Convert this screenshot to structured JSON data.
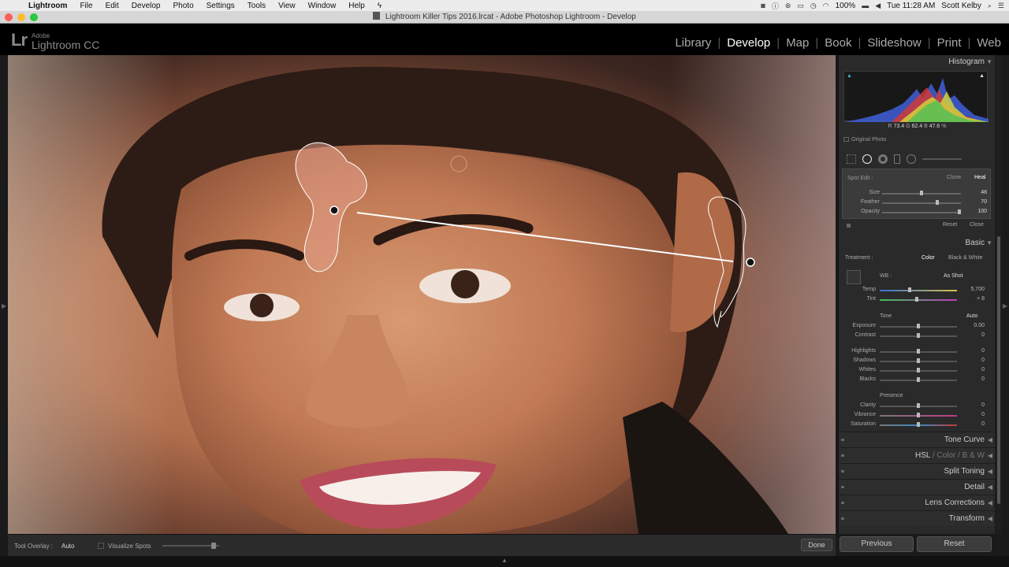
{
  "menubar": {
    "app": "Lightroom",
    "items": [
      "File",
      "Edit",
      "Develop",
      "Photo",
      "Settings",
      "Tools",
      "View",
      "Window",
      "Help"
    ],
    "battery": "100%",
    "clock": "Tue 11:28 AM",
    "user": "Scott Kelby"
  },
  "window": {
    "title": "Lightroom Killer Tips 2016.lrcat - Adobe Photoshop Lightroom - Develop"
  },
  "identity": {
    "adobe": "Adobe",
    "product": "Lightroom CC",
    "lr": "Lr"
  },
  "modules": [
    "Library",
    "Develop",
    "Map",
    "Book",
    "Slideshow",
    "Print",
    "Web"
  ],
  "active_module": "Develop",
  "histogram": {
    "title": "Histogram",
    "r_label": "R",
    "r_value": "73.4",
    "g_label": "G",
    "g_value": "62.4",
    "b_label": "B",
    "b_value": "47.6",
    "percent": "%",
    "original_photo": "Original Photo"
  },
  "spot_edit": {
    "title": "Spot Edit :",
    "clone": "Clone",
    "heal": "Heal",
    "size_label": "Size",
    "size_value": "48",
    "size_fraction": 0.48,
    "feather_label": "Feather",
    "feather_value": "70",
    "feather_fraction": 0.7,
    "opacity_label": "Opacity",
    "opacity_value": "100",
    "opacity_fraction": 1.0,
    "reset": "Reset",
    "close": "Close"
  },
  "basic": {
    "title": "Basic",
    "treatment_label": "Treatment :",
    "color": "Color",
    "bw": "Black & White",
    "wb_label": "WB :",
    "wb_value": "As Shot",
    "temp_label": "Temp",
    "temp_value": "5,700",
    "tint_label": "Tint",
    "tint_value": "+ 8",
    "tone_label": "Tone",
    "auto": "Auto",
    "exposure_label": "Exposure",
    "exposure_value": "0.00",
    "contrast_label": "Contrast",
    "contrast_value": "0",
    "highlights_label": "Highlights",
    "highlights_value": "0",
    "shadows_label": "Shadows",
    "shadows_value": "0",
    "whites_label": "Whites",
    "whites_value": "0",
    "blacks_label": "Blacks",
    "blacks_value": "0",
    "presence_label": "Presence",
    "clarity_label": "Clarity",
    "clarity_value": "0",
    "vibrance_label": "Vibrance",
    "vibrance_value": "0",
    "saturation_label": "Saturation",
    "saturation_value": "0"
  },
  "panels": {
    "tone_curve": "Tone Curve",
    "hsl": "HSL",
    "slash": "/",
    "color": "Color",
    "bw": "B & W",
    "split_toning": "Split Toning",
    "detail": "Detail",
    "lens_corrections": "Lens Corrections",
    "transform": "Transform"
  },
  "toolbar": {
    "tool_overlay_label": "Tool Overlay :",
    "tool_overlay_value": "Auto",
    "visualize_spots": "Visualize Spots",
    "done": "Done"
  },
  "buttons": {
    "previous": "Previous",
    "reset": "Reset"
  },
  "icons": {
    "apple": "apple-icon",
    "spot": "spot-removal-icon",
    "crop": "crop-icon"
  },
  "colors": {
    "accent": "#ffffff",
    "panel": "#2a2a2a"
  }
}
